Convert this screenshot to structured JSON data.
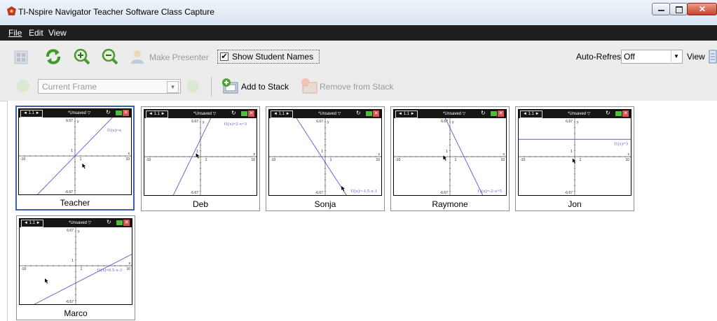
{
  "window": {
    "title": "TI-Nspire Navigator Teacher Software Class Capture"
  },
  "menu": {
    "items": [
      "File",
      "Edit",
      "View"
    ]
  },
  "toolbar": {
    "make_presenter": "Make Presenter",
    "show_student_names": "Show Student Names",
    "show_student_names_checked": true,
    "auto_refresh_label": "Auto-Refresh:",
    "auto_refresh_value": "Off",
    "view_label": "View"
  },
  "toolbar2": {
    "frame_select": "Current Frame",
    "add_to_stack": "Add to Stack",
    "remove_from_stack": "Remove from Stack"
  },
  "screen_common": {
    "page_tab": "1.1",
    "doc_title": "*Unsaved",
    "y_label": "y",
    "x_label": "x",
    "y_max": "6.67",
    "y_min": "-6.67",
    "x_min": "-10",
    "x_max": "10",
    "tick_one": "1"
  },
  "tiles": [
    {
      "name": "Teacher",
      "equation": "f1(x)=x",
      "slope": 1,
      "intercept": 0,
      "selected": true,
      "cursor": [
        1.3,
        -1.3
      ]
    },
    {
      "name": "Deb",
      "equation": "f1(x)=2·x+3",
      "slope": 2,
      "intercept": 3,
      "selected": false,
      "cursor": [
        -0.8,
        0.6
      ]
    },
    {
      "name": "Sonja",
      "equation": "f1(x)=-1.5·x-1",
      "slope": -1.5,
      "intercept": -1,
      "selected": false,
      "cursor": [
        2.9,
        -5.1
      ]
    },
    {
      "name": "Raymone",
      "equation": "f1(x)=-2·x+5",
      "slope": -2,
      "intercept": 5,
      "selected": false,
      "cursor": [
        -1.2,
        0.2
      ]
    },
    {
      "name": "Jon",
      "equation": "f1(x)=3",
      "slope": 0,
      "intercept": 3,
      "selected": false,
      "cursor": [
        -0.4,
        -0.3
      ]
    },
    {
      "name": "Marco",
      "equation": "f1(x)=0.5·x-3",
      "slope": 0.5,
      "intercept": -3,
      "selected": false,
      "cursor": [
        -5.5,
        -2.2
      ]
    }
  ],
  "colors": {
    "graph_line": "#5a5ad2",
    "selected_border": "#3b5fb5",
    "menubar": "#1e1e1e"
  }
}
